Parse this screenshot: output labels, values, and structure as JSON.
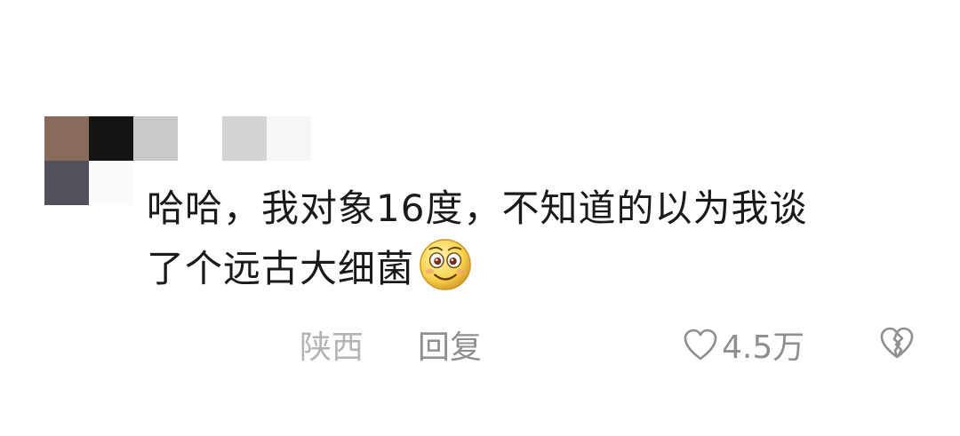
{
  "comment": {
    "line1": "哈哈，我对象16度，不知道的以为我谈",
    "line2": "了个远古大细菌",
    "emoji": "smile-emoji-icon"
  },
  "meta": {
    "location": "陕西",
    "reply_label": "回复",
    "like_count": "4.5万"
  },
  "colors": {
    "text": "#1a1a1a",
    "meta": "#9a9a9a",
    "location": "#b3b3b3"
  }
}
